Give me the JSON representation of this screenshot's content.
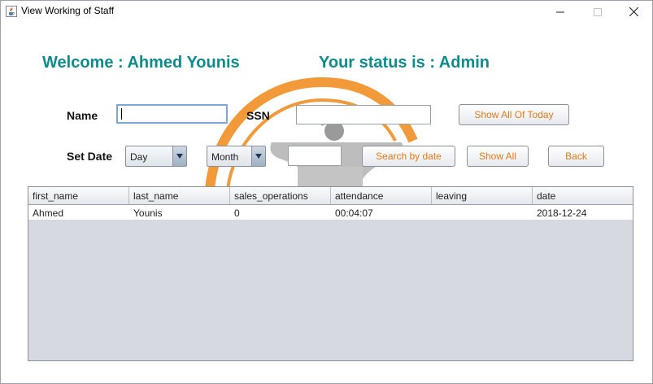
{
  "window": {
    "title": "View Working of Staff",
    "minimize_symbol": "—",
    "maximize_symbol": "☐",
    "close_symbol": "✕"
  },
  "header": {
    "welcome_text": "Welcome : Ahmed Younis",
    "status_text": "Your status is : Admin",
    "accent_color": "#0e8c8c"
  },
  "form": {
    "name_label": "Name",
    "name_value": "",
    "ssn_label": "SSN",
    "ssn_value": "",
    "show_all_today_label": "Show All Of Today",
    "set_date_label": "Set Date",
    "day_select": "Day",
    "month_select": "Month",
    "year_value": "",
    "search_by_date_label": "Search by date",
    "show_all_label": "Show All",
    "back_label": "Back",
    "button_text_color": "#e07c1a"
  },
  "table": {
    "columns": [
      "first_name",
      "last_name",
      "sales_operations",
      "attendance",
      "leaving",
      "date"
    ],
    "rows": [
      [
        "Ahmed",
        "Younis",
        "0",
        "00:04:07",
        "",
        "2018-12-24"
      ]
    ]
  },
  "icons": {
    "app": "java-cup-icon",
    "background_logo": "anvil-logo-icon"
  }
}
